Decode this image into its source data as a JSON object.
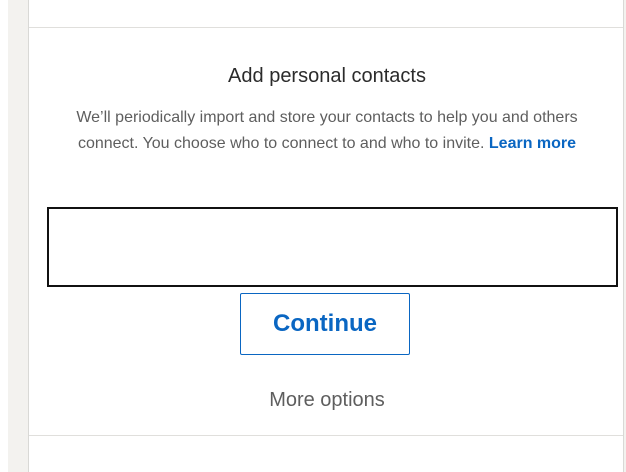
{
  "card": {
    "title": "Add personal contacts",
    "description": "We’ll periodically import and store your contacts to help you and others connect. You choose who to connect to and who to invite.",
    "learn_more": "Learn more"
  },
  "email_input": {
    "value": "",
    "placeholder": ""
  },
  "actions": {
    "continue_label": "Continue",
    "more_options_label": "More options"
  },
  "colors": {
    "accent": "#0a66c2",
    "text_secondary": "#5e5e5e",
    "page_bg": "#f3f2ef"
  }
}
